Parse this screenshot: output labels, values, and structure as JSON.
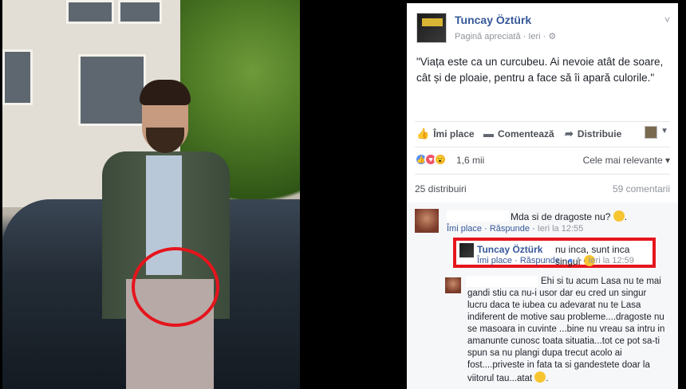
{
  "post": {
    "page_name": "Tuncay Öztürk",
    "meta": "Pagină apreciată · Ieri · ⚙",
    "quote": "\"Viața este ca un curcubeu. Ai nevoie atât de soare, cât și de ploaie, pentru a face să îi apară culorile.\"",
    "chevron": "˅"
  },
  "actions": {
    "like": "Îmi place",
    "comment": "Comentează",
    "share": "Distribuie",
    "caret": "▼"
  },
  "reactions": {
    "count": "1,6 mii",
    "relevance": "Cele mai relevante ▾"
  },
  "stats": {
    "shares": "25 distribuiri",
    "comments": "59 comentarii"
  },
  "comments": {
    "c1": {
      "text": "Mda si de dragoste nu?",
      "like": "Îmi place",
      "reply": "Răspunde",
      "time": "Ieri la 12:55"
    },
    "reply": {
      "name": "Tuncay Öztürk",
      "text": "nu inca, sunt inca singur",
      "like": "Îmi place",
      "reply": "Răspunde",
      "likes": "4",
      "time": "Ieri la 12:59"
    },
    "c3": {
      "text": "Ehi si tu acum Lasa nu te mai gandi stiu ca nu-i usor dar eu cred un singur lucru daca te iubea cu adevarat nu te Lasa indiferent de motive sau probleme....dragoste nu se masoara in cuvinte ...bine nu vreau sa intru in amanunte cunosc toata situatia...tot ce pot sa-ti spun sa nu plangi dupa trecut acolo ai fost....priveste in fata ta si gandestete doar la viitorul tau...atat"
    }
  }
}
